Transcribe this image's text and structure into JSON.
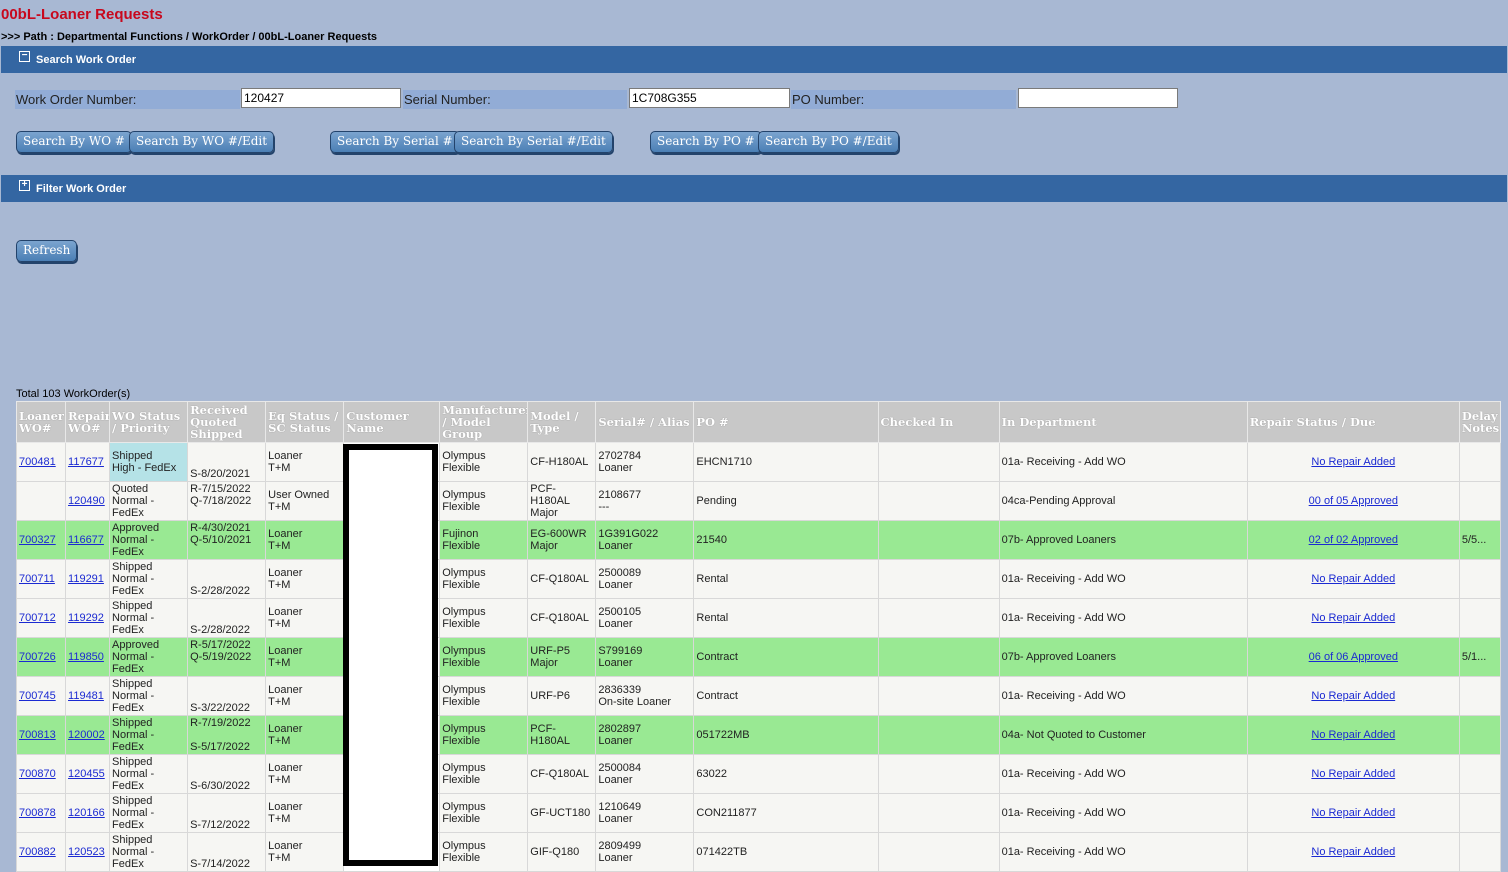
{
  "page": {
    "title": "00bL-Loaner Requests",
    "breadcrumb": ">>> Path : Departmental Functions / WorkOrder / 00bL-Loaner Requests"
  },
  "search_section": {
    "title": "Search Work Order",
    "toggle_symbol": "−",
    "fields": {
      "wo_label": "Work Order Number:",
      "wo_value": "120427",
      "serial_label": "Serial Number:",
      "serial_value": "1C708G355",
      "po_label": "PO Number:",
      "po_value": ""
    },
    "buttons": {
      "search_wo": "Search By WO #",
      "search_wo_edit": "Search By WO #/Edit",
      "search_serial": "Search By Serial #",
      "search_serial_edit": "Search By Serial #/Edit",
      "search_po": "Search By PO #",
      "search_po_edit": "Search By PO #/Edit"
    }
  },
  "filter_section": {
    "title": "Filter Work Order",
    "toggle_symbol": "+"
  },
  "refresh_label": "Refresh",
  "total_text": "Total 103 WorkOrder(s)",
  "table": {
    "headers": {
      "loaner": "Loaner WO#",
      "repair": "Repair WO#",
      "status": "WO Status / Priority",
      "received": "Received Quoted Shipped",
      "eq": "Eq Status / SC Status",
      "customer": "Customer Name",
      "manufacturer": "Manufacturer / Model Group",
      "model": "Model / Type",
      "serial": "Serial# / Alias",
      "po": "PO #",
      "checked": "Checked In",
      "dept": "In Department",
      "repair_status": "Repair Status / Due",
      "delay": "Delay Notes"
    },
    "rows": [
      {
        "loaner": "700481",
        "repair": "117677",
        "status": [
          "Shipped",
          "High - FedEx"
        ],
        "dates": [
          "",
          "",
          "S-8/20/2021"
        ],
        "eq": [
          "Loaner",
          "T+M"
        ],
        "mfr": [
          "Olympus",
          "Flexible"
        ],
        "model": [
          "CF-H180AL"
        ],
        "serial": [
          "2702784",
          "Loaner"
        ],
        "po": "EHCN1710",
        "dept": "01a- Receiving - Add WO",
        "repair_status": "No Repair Added",
        "delay": ""
      },
      {
        "loaner": "",
        "repair": "120490",
        "status": [
          "Quoted",
          "Normal -",
          "FedEx"
        ],
        "dates": [
          "R-7/15/2022",
          "Q-7/18/2022",
          ""
        ],
        "eq": [
          "User Owned",
          "T+M"
        ],
        "mfr": [
          "Olympus",
          "Flexible"
        ],
        "model": [
          "PCF-",
          "H180AL",
          "Major"
        ],
        "serial": [
          "2108677",
          "---"
        ],
        "po": "Pending",
        "dept": "04ca-Pending Approval",
        "repair_status": "00 of 05 Approved",
        "delay": ""
      },
      {
        "loaner": "700327",
        "repair": "116677",
        "status": [
          "Approved",
          "Normal -",
          "FedEx"
        ],
        "dates": [
          "R-4/30/2021",
          "Q-5/10/2021",
          ""
        ],
        "eq": [
          "Loaner",
          "T+M"
        ],
        "mfr": [
          "Fujinon",
          "Flexible"
        ],
        "model": [
          "EG-600WR",
          "Major"
        ],
        "serial": [
          "1G391G022",
          "Loaner"
        ],
        "po": "21540",
        "dept": "07b- Approved Loaners",
        "repair_status": "02 of 02 Approved",
        "delay": "5/5..."
      },
      {
        "loaner": "700711",
        "repair": "119291",
        "status": [
          "Shipped",
          "Normal -",
          "FedEx"
        ],
        "dates": [
          "",
          "",
          "S-2/28/2022"
        ],
        "eq": [
          "Loaner",
          "T+M"
        ],
        "mfr": [
          "Olympus",
          "Flexible"
        ],
        "model": [
          "CF-Q180AL"
        ],
        "serial": [
          "2500089",
          "Loaner"
        ],
        "po": "Rental",
        "dept": "01a- Receiving - Add WO",
        "repair_status": "No Repair Added",
        "delay": ""
      },
      {
        "loaner": "700712",
        "repair": "119292",
        "status": [
          "Shipped",
          "Normal -",
          "FedEx"
        ],
        "dates": [
          "",
          "",
          "S-2/28/2022"
        ],
        "eq": [
          "Loaner",
          "T+M"
        ],
        "mfr": [
          "Olympus",
          "Flexible"
        ],
        "model": [
          "CF-Q180AL"
        ],
        "serial": [
          "2500105",
          "Loaner"
        ],
        "po": "Rental",
        "dept": "01a- Receiving - Add WO",
        "repair_status": "No Repair Added",
        "delay": ""
      },
      {
        "loaner": "700726",
        "repair": "119850",
        "status": [
          "Approved",
          "Normal -",
          "FedEx"
        ],
        "dates": [
          "R-5/17/2022",
          "Q-5/19/2022",
          ""
        ],
        "eq": [
          "Loaner",
          "T+M"
        ],
        "mfr": [
          "Olympus",
          "Flexible"
        ],
        "model": [
          "URF-P5",
          "Major"
        ],
        "serial": [
          "S799169",
          "Loaner"
        ],
        "po": "Contract",
        "dept": "07b- Approved Loaners",
        "repair_status": "06 of 06 Approved",
        "delay": "5/1..."
      },
      {
        "loaner": "700745",
        "repair": "119481",
        "status": [
          "Shipped",
          "Normal -",
          "FedEx"
        ],
        "dates": [
          "",
          "",
          "S-3/22/2022"
        ],
        "eq": [
          "Loaner",
          "T+M"
        ],
        "mfr": [
          "Olympus",
          "Flexible"
        ],
        "model": [
          "URF-P6"
        ],
        "serial": [
          "2836339",
          "On-site Loaner"
        ],
        "po": "Contract",
        "dept": "01a- Receiving - Add WO",
        "repair_status": "No Repair Added",
        "delay": ""
      },
      {
        "loaner": "700813",
        "repair": "120002",
        "status": [
          "Shipped",
          "Normal -",
          "FedEx"
        ],
        "dates": [
          "R-7/19/2022",
          "",
          "S-5/17/2022"
        ],
        "eq": [
          "Loaner",
          "T+M"
        ],
        "mfr": [
          "Olympus",
          "Flexible"
        ],
        "model": [
          "PCF-",
          "H180AL"
        ],
        "serial": [
          "2802897",
          "Loaner"
        ],
        "po": "051722MB",
        "dept": "04a- Not Quoted to Customer",
        "repair_status": "No Repair Added",
        "delay": ""
      },
      {
        "loaner": "700870",
        "repair": "120455",
        "status": [
          "Shipped",
          "Normal -",
          "FedEx"
        ],
        "dates": [
          "",
          "",
          "S-6/30/2022"
        ],
        "eq": [
          "Loaner",
          "T+M"
        ],
        "mfr": [
          "Olympus",
          "Flexible"
        ],
        "model": [
          "CF-Q180AL"
        ],
        "serial": [
          "2500084",
          "Loaner"
        ],
        "po": "63022",
        "dept": "01a- Receiving - Add WO",
        "repair_status": "No Repair Added",
        "delay": ""
      },
      {
        "loaner": "700878",
        "repair": "120166",
        "status": [
          "Shipped",
          "Normal -",
          "FedEx"
        ],
        "dates": [
          "",
          "",
          "S-7/12/2022"
        ],
        "eq": [
          "Loaner",
          "T+M"
        ],
        "mfr": [
          "Olympus",
          "Flexible"
        ],
        "model": [
          "GF-UCT180"
        ],
        "serial": [
          "1210649",
          "Loaner"
        ],
        "po": "CON211877",
        "dept": "01a- Receiving - Add WO",
        "repair_status": "No Repair Added",
        "delay": ""
      },
      {
        "loaner": "700882",
        "repair": "120523",
        "status": [
          "Shipped",
          "Normal -",
          "FedEx"
        ],
        "dates": [
          "",
          "",
          "S-7/14/2022"
        ],
        "eq": [
          "Loaner",
          "T+M"
        ],
        "mfr": [
          "Olympus",
          "Flexible"
        ],
        "model": [
          "GIF-Q180"
        ],
        "serial": [
          "2809499",
          "Loaner"
        ],
        "po": "071422TB",
        "dept": "01a- Receiving - Add WO",
        "repair_status": "No Repair Added",
        "delay": ""
      }
    ]
  },
  "row_colors": {
    "white": "#f6f6f3",
    "green": "#99e993",
    "cyan": "#b5e2e7"
  },
  "green_rows": [
    2,
    5,
    7
  ]
}
